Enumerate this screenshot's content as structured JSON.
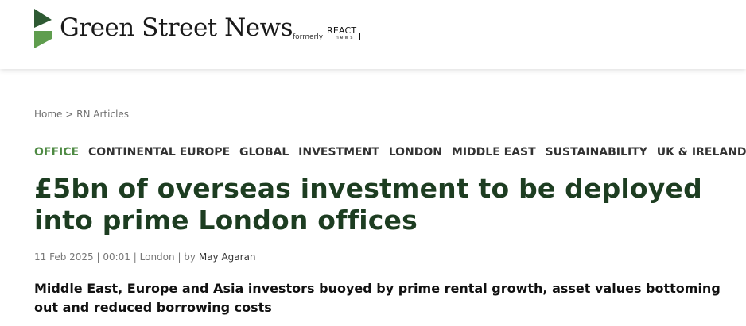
{
  "header": {
    "brand_name": "Green Street News",
    "formerly_label": "formerly",
    "former_brand": "REACT",
    "former_brand_sub": "news",
    "brand_color": "#2e5a33",
    "brand_accent": "#5f9d4e"
  },
  "breadcrumb": {
    "home": "Home",
    "separator": ">",
    "section": "RN Articles"
  },
  "tags": [
    {
      "label": "OFFICE"
    },
    {
      "label": "CONTINENTAL EUROPE"
    },
    {
      "label": "GLOBAL"
    },
    {
      "label": "INVESTMENT"
    },
    {
      "label": "LONDON"
    },
    {
      "label": "MIDDLE EAST"
    },
    {
      "label": "SUSTAINABILITY"
    },
    {
      "label": "UK & IRELAND"
    }
  ],
  "article": {
    "title": "£5bn of overseas investment to be deployed into prime London offices",
    "date": "11 Feb 2025",
    "time": "00:01",
    "location": "London",
    "by_label": "by",
    "author": "May Agaran",
    "standfirst": "Middle East, Europe and Asia investors buoyed by prime rental growth, asset values bottoming out and reduced borrowing costs",
    "title_color": "#1d3d21",
    "tag_active_color": "#4e8a43"
  }
}
